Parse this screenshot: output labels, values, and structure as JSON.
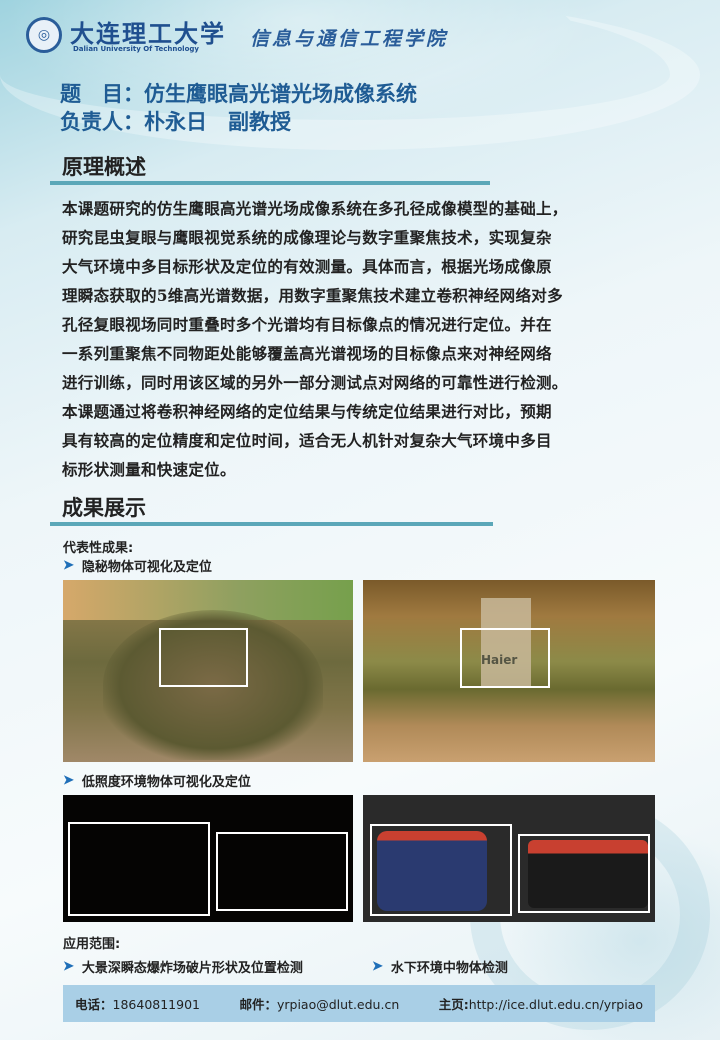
{
  "header": {
    "university_cn": "大连理工大学",
    "university_en": "Dalian University Of Technology",
    "college": "信息与通信工程学院"
  },
  "project": {
    "title_label": "题　目：",
    "title": "仿生鹰眼高光谱光场成像系统",
    "lead_label": "负责人：",
    "lead": "朴永日　副教授"
  },
  "principle": {
    "heading": "原理概述",
    "lines": [
      "本课题研究的仿生鹰眼高光谱光场成像系统在多孔径成像模型的基础上，",
      "研究昆虫复眼与鹰眼视觉系统的成像理论与数字重聚焦技术，实现复杂",
      "大气环境中多目标形状及定位的有效测量。具体而言，根据光场成像原",
      "理瞬态获取的5维高光谱数据，用数字重聚焦技术建立卷积神经网络对多",
      "孔径复眼视场同时重叠时多个光谱均有目标像点的情况进行定位。并在",
      "一系列重聚焦不同物距处能够覆盖高光谱视场的目标像点来对神经网络",
      "进行训练，同时用该区域的另外一部分测试点对网络的可靠性进行检测。",
      "本课题通过将卷积神经网络的定位结果与传统定位结果进行对比，预期",
      "具有较高的定位精度和定位时间，适合无人机针对复杂大气环境中多目",
      "标形状测量和快速定位。"
    ]
  },
  "results": {
    "heading": "成果展示",
    "subheading": "代表性成果:",
    "items": [
      "隐秘物体可视化及定位",
      "低照度环境物体可视化及定位"
    ],
    "photo_text": "Haier"
  },
  "applications": {
    "heading": "应用范围:",
    "items": [
      "大景深瞬态爆炸场破片形状及位置检测",
      "水下环境中物体检测"
    ]
  },
  "contact": {
    "phone_label": "电话：",
    "phone": "18640811901",
    "email_label": "邮件：",
    "email": "yrpiao@dlut.edu.cn",
    "home_label": "主页:",
    "home": "http://ice.dlut.edu.cn/yrpiao"
  },
  "colors": {
    "accent": "#1f5c94",
    "bar": "#5ba7b8",
    "footer": "#a9cfe6"
  }
}
